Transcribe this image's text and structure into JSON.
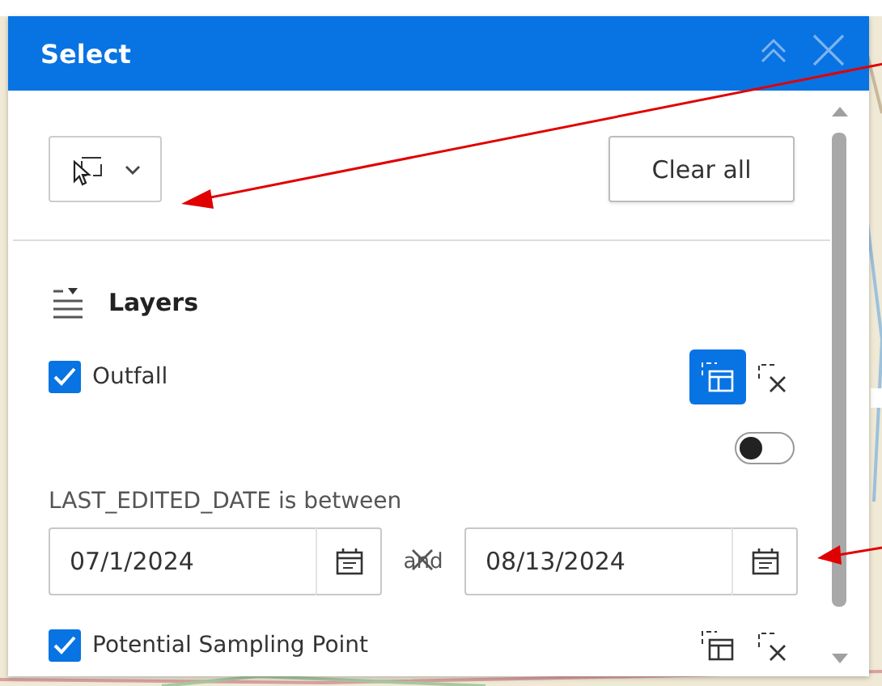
{
  "panel": {
    "title": "Select"
  },
  "clear_button": "Clear all",
  "layers_heading": "Layers",
  "layers": [
    {
      "name": "Outfall",
      "checked": true,
      "select_active": true,
      "toggle": {
        "on": false
      },
      "filter": {
        "label": "LAST_EDITED_DATE is between",
        "from": "07/1/2024",
        "joiner": "and",
        "to": "08/13/2024"
      }
    },
    {
      "name": "Potential Sampling Point",
      "checked": true,
      "select_active": false
    }
  ]
}
